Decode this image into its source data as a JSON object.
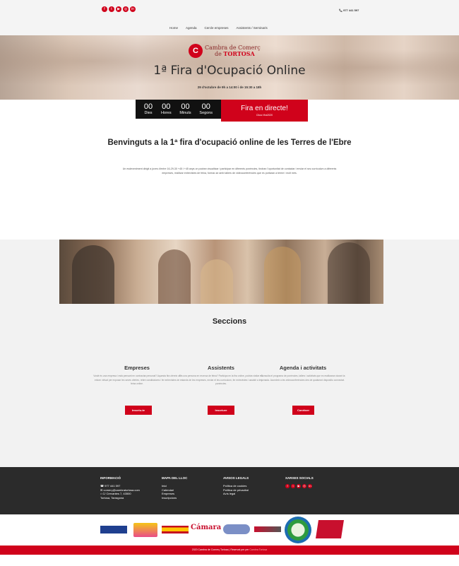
{
  "topbar": {
    "social_icons": [
      {
        "name": "facebook-icon",
        "glyph": "f"
      },
      {
        "name": "twitter-icon",
        "glyph": "t"
      },
      {
        "name": "youtube-icon",
        "glyph": "▶"
      },
      {
        "name": "instagram-icon",
        "glyph": "◎"
      },
      {
        "name": "linkedin-icon",
        "glyph": "in"
      }
    ],
    "phone": "📞 977 441 597"
  },
  "nav": {
    "items": [
      "Home",
      "Agenda",
      "Cercle empreses",
      "Assistents / Seminaris"
    ]
  },
  "hero": {
    "logo_line1": "Cambra de Comerç",
    "logo_line2_prefix": "de ",
    "logo_line2_city": "TORTOSA",
    "title": "1ª Fira d'Ocupació Online",
    "date": "29 d'octubre de 9h a 14:00 i de 15:30 a 18h"
  },
  "countdown": {
    "days": "00",
    "days_label": "Dies",
    "hours": "00",
    "hours_label": "Hores",
    "minutes": "00",
    "minutes_label": "Minuts",
    "seconds": "00",
    "seconds_label": "Segons"
  },
  "live": {
    "title": "Fira en directe!",
    "subtitle": "Clica i fira2020"
  },
  "welcome": {
    "title": "Benvinguts a la 1ª fira d'ocupació online de les Terres de l'Ebre",
    "text": "Un esdeveniment dirigit a joves d'entre 16-29-30 +45 i +45 anys on podran visualitzar i participar en diferents ponències, tindran l'oportunitat de contactar i enviar el seu currículum a diferents empreses, realitzar entrevistes de feina, formar-se amb tallers de videoconferències que es portaran a terme i molt més."
  },
  "seccions": {
    "title": "Seccions",
    "cols": [
      {
        "title": "Empreses",
        "text": "Vostè és una empresa i està pensant en contractar personal? Aquesta fira ofereix un entorn virtual per exposar les seves ofertes, rebre candidatures i fer entrevistes de feina online.",
        "button": "Inscriu-te"
      },
      {
        "title": "Assistents",
        "text": "Ets una persona en recerca de feina? Participa en la fira online, podràs visitar els estands de les empreses, enviar el teu currículum, fer entrevistes i assistir a les ponències.",
        "button": "Inscriure"
      },
      {
        "title": "Agenda i activitats",
        "text": "Consulta el programa de ponències, tallers i activitats que es realitzaran durant la jornada. Accedeix a les videoconferències des de qualsevol dispositiu connectat.",
        "button": "Conèixer"
      }
    ]
  },
  "footer": {
    "info_title": "INFORMACIÓ",
    "info_items": [
      "977 441 597",
      "comerç@cambratortosa.com",
      "C/ Cervantes 7, 43500",
      "Tortosa, Tarragona"
    ],
    "map_title": "MAPA DEL LLOC",
    "map_items": [
      "Inici",
      "Calendari",
      "Empreses",
      "Inscripcions"
    ],
    "legal_title": "AVISOS LEGALS",
    "legal_items": [
      "Política de cookies",
      "Política de privacitat",
      "Avís legal"
    ],
    "social_title": "XARXES SOCIALS",
    "social_icons": [
      {
        "name": "facebook-icon",
        "glyph": "f"
      },
      {
        "name": "twitter-icon",
        "glyph": "t"
      },
      {
        "name": "youtube-icon",
        "glyph": "▶"
      },
      {
        "name": "instagram-icon",
        "glyph": "◎"
      },
      {
        "name": "linkedin-icon",
        "glyph": "in"
      }
    ]
  },
  "sponsors": {
    "camara": "Cámara"
  },
  "bottom": {
    "text": "2020 Cambra de Comerç Tortosa | Reservat per per ",
    "link": "Cambra Tortosa"
  },
  "colors": {
    "accent": "#d0021b",
    "footer": "#2b2b2b",
    "grey": "#f2f2f2"
  }
}
